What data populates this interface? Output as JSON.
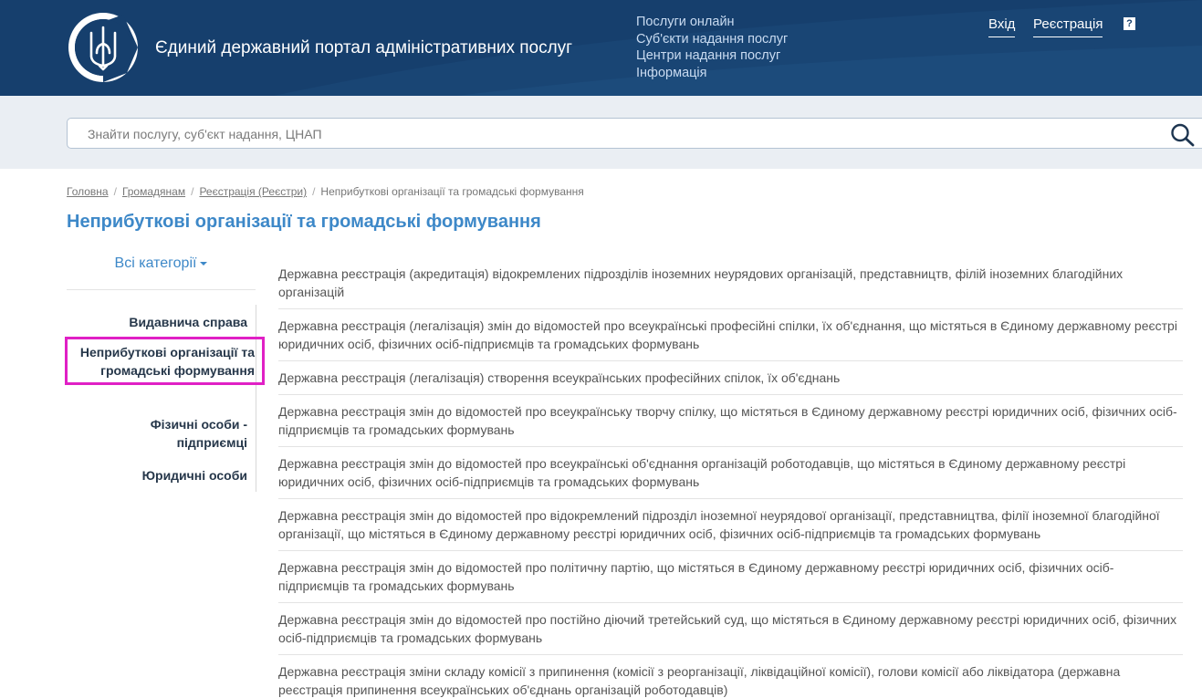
{
  "header": {
    "site_title": "Єдиний державний портал адміністративних послуг",
    "nav": [
      "Послуги онлайн",
      "Суб'єкти надання послуг",
      "Центри надання послуг",
      "Інформація"
    ],
    "login_label": "Вхід",
    "register_label": "Реєстрація",
    "help_label": "?"
  },
  "search": {
    "placeholder": "Знайти послугу, суб'єкт надання, ЦНАП"
  },
  "breadcrumb": {
    "items": [
      "Головна",
      "Громадянам",
      "Реєстрація (Реєстри)"
    ],
    "current": "Неприбуткові організації та громадські формування"
  },
  "page_title": "Неприбуткові організації та громадські формування",
  "sidebar": {
    "dropdown_label": "Всі категорії",
    "items": [
      "Видавнича справа",
      "Неприбуткові організації та громадські формування",
      "Фізичні особи - підприємці",
      "Юридичні особи"
    ]
  },
  "services": [
    "Державна реєстрація (акредитація) відокремлених підрозділів іноземних неурядових організацій, представництв, філій іноземних благодійних організацій",
    "Державна реєстрація (легалізація) змін до відомостей про всеукраїнські професійні спілки, їх об'єднання, що містяться в Єдиному державному реєстрі юридичних осіб, фізичних осіб-підприємців та громадських формувань",
    "Державна реєстрація (легалізація) створення всеукраїнських професійних спілок, їх об'єднань",
    "Державна реєстрація змін до відомостей про всеукраїнську творчу спілку, що містяться в Єдиному державному реєстрі юридичних осіб, фізичних осіб-підприємців та громадських формувань",
    "Державна реєстрація змін до відомостей про всеукраїнські об'єднання організацій роботодавців, що містяться в Єдиному державному реєстрі юридичних осіб, фізичних осіб-підприємців та громадських формувань",
    "Державна реєстрація змін до відомостей про відокремлений підрозділ іноземної неурядової організації, представництва, філії іноземної благодійної організації, що містяться в Єдиному державному реєстрі юридичних осіб, фізичних осіб-підприємців та громадських формувань",
    "Державна реєстрація змін до відомостей про політичну партію, що містяться в Єдиному державному реєстрі юридичних осіб, фізичних осіб-підприємців та громадських формувань",
    "Державна реєстрація змін до відомостей про постійно діючий третейський суд, що містяться в Єдиному державному реєстрі юридичних осіб, фізичних осіб-підприємців та громадських формувань",
    "Державна реєстрація зміни складу комісії з припинення (комісії з реорганізації, ліквідаційної комісії), голови комісії або ліквідатора (державна реєстрація припинення всеукраїнських об'єднань організацій роботодавців)"
  ],
  "colors": {
    "header_bg": "#163f6d",
    "accent": "#3d88c8",
    "highlight": "#e020c5"
  }
}
